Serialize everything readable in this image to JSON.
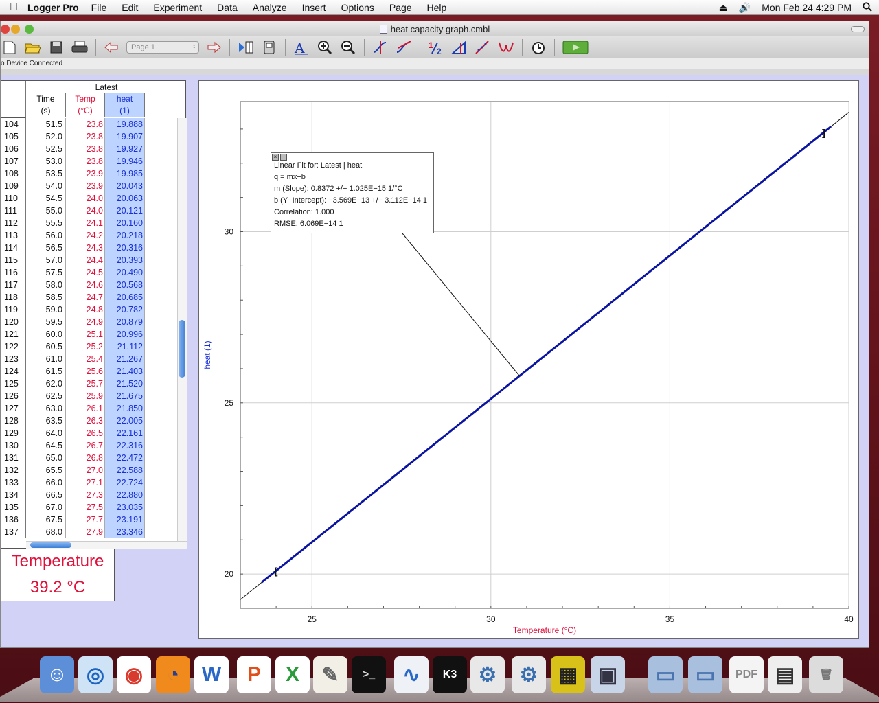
{
  "menubar": {
    "app_name": "Logger Pro",
    "menus": [
      "File",
      "Edit",
      "Experiment",
      "Data",
      "Analyze",
      "Insert",
      "Options",
      "Page",
      "Help"
    ],
    "clock": "Mon Feb 24  4:29 PM"
  },
  "window": {
    "title": "heat capacity graph.cmbl",
    "page_select": "Page 1",
    "status": "o Device Connected"
  },
  "table": {
    "dataset": "Latest",
    "columns": [
      {
        "name": "Time",
        "unit": "(s)",
        "color": "#111111"
      },
      {
        "name": "Temp",
        "unit": "(°C)",
        "color": "#e0103a"
      },
      {
        "name": "heat",
        "unit": "(1)",
        "color": "#1a2fd6"
      }
    ],
    "rows": [
      [
        "104",
        "51.5",
        "23.8",
        "19.888"
      ],
      [
        "105",
        "52.0",
        "23.8",
        "19.907"
      ],
      [
        "106",
        "52.5",
        "23.8",
        "19.927"
      ],
      [
        "107",
        "53.0",
        "23.8",
        "19.946"
      ],
      [
        "108",
        "53.5",
        "23.9",
        "19.985"
      ],
      [
        "109",
        "54.0",
        "23.9",
        "20.043"
      ],
      [
        "110",
        "54.5",
        "24.0",
        "20.063"
      ],
      [
        "111",
        "55.0",
        "24.0",
        "20.121"
      ],
      [
        "112",
        "55.5",
        "24.1",
        "20.160"
      ],
      [
        "113",
        "56.0",
        "24.2",
        "20.218"
      ],
      [
        "114",
        "56.5",
        "24.3",
        "20.316"
      ],
      [
        "115",
        "57.0",
        "24.4",
        "20.393"
      ],
      [
        "116",
        "57.5",
        "24.5",
        "20.490"
      ],
      [
        "117",
        "58.0",
        "24.6",
        "20.568"
      ],
      [
        "118",
        "58.5",
        "24.7",
        "20.685"
      ],
      [
        "119",
        "59.0",
        "24.8",
        "20.782"
      ],
      [
        "120",
        "59.5",
        "24.9",
        "20.879"
      ],
      [
        "121",
        "60.0",
        "25.1",
        "20.996"
      ],
      [
        "122",
        "60.5",
        "25.2",
        "21.112"
      ],
      [
        "123",
        "61.0",
        "25.4",
        "21.267"
      ],
      [
        "124",
        "61.5",
        "25.6",
        "21.403"
      ],
      [
        "125",
        "62.0",
        "25.7",
        "21.520"
      ],
      [
        "126",
        "62.5",
        "25.9",
        "21.675"
      ],
      [
        "127",
        "63.0",
        "26.1",
        "21.850"
      ],
      [
        "128",
        "63.5",
        "26.3",
        "22.005"
      ],
      [
        "129",
        "64.0",
        "26.5",
        "22.161"
      ],
      [
        "130",
        "64.5",
        "26.7",
        "22.316"
      ],
      [
        "131",
        "65.0",
        "26.8",
        "22.472"
      ],
      [
        "132",
        "65.5",
        "27.0",
        "22.588"
      ],
      [
        "133",
        "66.0",
        "27.1",
        "22.724"
      ],
      [
        "134",
        "66.5",
        "27.3",
        "22.880"
      ],
      [
        "135",
        "67.0",
        "27.5",
        "23.035"
      ],
      [
        "136",
        "67.5",
        "27.7",
        "23.191"
      ],
      [
        "137",
        "68.0",
        "27.9",
        "23.346"
      ]
    ]
  },
  "meter": {
    "label": "Temperature",
    "value": "39.2 °C"
  },
  "fit_box": {
    "lines": [
      "Linear Fit for: Latest | heat",
      "q = mx+b",
      "m (Slope): 0.8372 +/− 1.025E−15 1/°C",
      "b (Y−Intercept): −3.569E−13 +/− 3.112E−14 1",
      "Correlation: 1.000",
      "RMSE: 6.069E−14 1"
    ]
  },
  "chart_data": {
    "type": "line",
    "title": "",
    "xlabel": "Temperature (°C)",
    "ylabel": "heat (1)",
    "xlim": [
      23,
      40
    ],
    "ylim": [
      19,
      33.8
    ],
    "x_ticks": [
      25,
      30,
      35,
      40
    ],
    "y_ticks": [
      20,
      25,
      30
    ],
    "grid": true,
    "series": [
      {
        "name": "heat",
        "color": "#0a14a0",
        "x": [
          23.6,
          39.5
        ],
        "y": [
          19.76,
          33.07
        ]
      }
    ],
    "fit_line": {
      "slope": 0.8372,
      "intercept": 0,
      "x_range": [
        23,
        40
      ],
      "color": "#111111"
    },
    "brackets_x": [
      24.0,
      39.3
    ]
  },
  "dock": {
    "icons": [
      "finder-icon",
      "safari-icon",
      "chrome-icon",
      "firefox-icon",
      "word-icon",
      "powerpoint-icon",
      "excel-icon",
      "textedit-icon",
      "terminal-icon",
      "grapher-icon",
      "k3-icon",
      "python-icon",
      "python-launcher-icon",
      "labquest-icon",
      "iphoto-icon",
      "applications-folder-icon",
      "documents-folder-icon",
      "pdf-icon",
      "screenshot-icon",
      "trash-icon"
    ]
  }
}
